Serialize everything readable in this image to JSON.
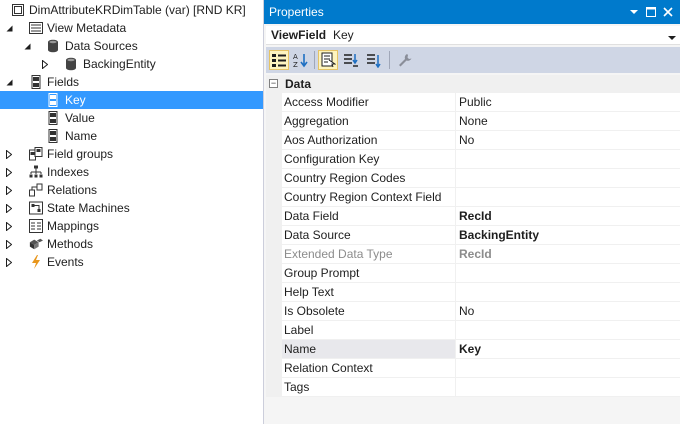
{
  "tree": {
    "items": [
      {
        "label": "DimAttributeKRDimTable (var) [RND KR]",
        "icon": "table-icon",
        "expander": "none",
        "level": 0
      },
      {
        "label": "View Metadata",
        "icon": "metadata-icon",
        "expander": "expanded",
        "level": 1
      },
      {
        "label": "Data Sources",
        "icon": "database-icon",
        "expander": "expanded",
        "level": 2
      },
      {
        "label": "BackingEntity",
        "icon": "database-icon",
        "expander": "collapsed",
        "level": 3
      },
      {
        "label": "Fields",
        "icon": "field-icon",
        "expander": "expanded",
        "level": 1
      },
      {
        "label": "Key",
        "icon": "field-icon",
        "expander": "none",
        "level": 2,
        "selected": true
      },
      {
        "label": "Value",
        "icon": "field-icon",
        "expander": "none",
        "level": 2
      },
      {
        "label": "Name",
        "icon": "field-icon",
        "expander": "none",
        "level": 2
      },
      {
        "label": "Field groups",
        "icon": "field-groups-icon",
        "expander": "collapsed",
        "level": 1
      },
      {
        "label": "Indexes",
        "icon": "indexes-icon",
        "expander": "collapsed",
        "level": 1
      },
      {
        "label": "Relations",
        "icon": "relations-icon",
        "expander": "collapsed",
        "level": 1
      },
      {
        "label": "State Machines",
        "icon": "state-machines-icon",
        "expander": "collapsed",
        "level": 1
      },
      {
        "label": "Mappings",
        "icon": "mappings-icon",
        "expander": "collapsed",
        "level": 1
      },
      {
        "label": "Methods",
        "icon": "methods-icon",
        "expander": "collapsed",
        "level": 1
      },
      {
        "label": "Events",
        "icon": "lightning-icon",
        "expander": "collapsed",
        "level": 1
      }
    ]
  },
  "properties": {
    "title": "Properties",
    "object_name": "ViewField",
    "object_type": "Key",
    "category": "Data",
    "rows": [
      {
        "name": "Access Modifier",
        "value": "Public"
      },
      {
        "name": "Aggregation",
        "value": "None"
      },
      {
        "name": "Aos Authorization",
        "value": "No"
      },
      {
        "name": "Configuration Key",
        "value": ""
      },
      {
        "name": "Country Region Codes",
        "value": ""
      },
      {
        "name": "Country Region Context Field",
        "value": ""
      },
      {
        "name": "Data Field",
        "value": "RecId",
        "bold": true
      },
      {
        "name": "Data Source",
        "value": "BackingEntity",
        "bold": true
      },
      {
        "name": "Extended Data Type",
        "value": "RecId",
        "bold": true,
        "dim": true
      },
      {
        "name": "Group Prompt",
        "value": ""
      },
      {
        "name": "Help Text",
        "value": ""
      },
      {
        "name": "Is Obsolete",
        "value": "No"
      },
      {
        "name": "Label",
        "value": ""
      },
      {
        "name": "Name",
        "value": "Key",
        "bold": true,
        "selected": true
      },
      {
        "name": "Relation Context",
        "value": ""
      },
      {
        "name": "Tags",
        "value": ""
      }
    ]
  },
  "colors": {
    "title_bar": "#007acc",
    "tree_selection": "#3399ff",
    "toolbar": "#cfd6e5"
  }
}
